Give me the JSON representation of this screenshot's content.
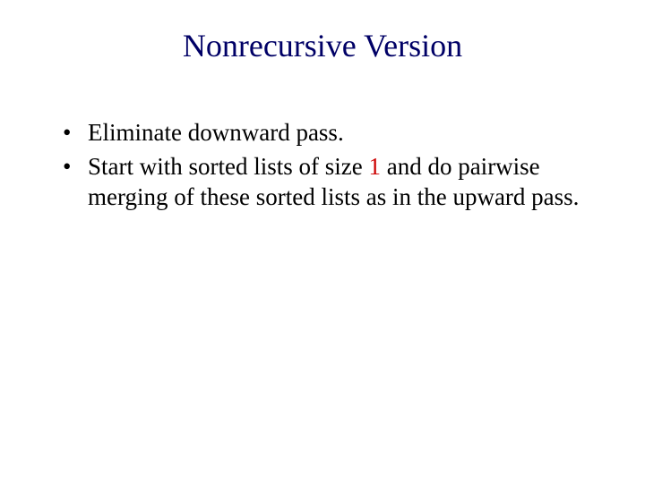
{
  "title": "Nonrecursive Version",
  "bullets": {
    "b1": "Eliminate downward pass.",
    "b2_pre": "Start with sorted lists of size ",
    "b2_num": "1",
    "b2_post": " and do pairwise merging of these sorted lists as in the upward pass."
  }
}
